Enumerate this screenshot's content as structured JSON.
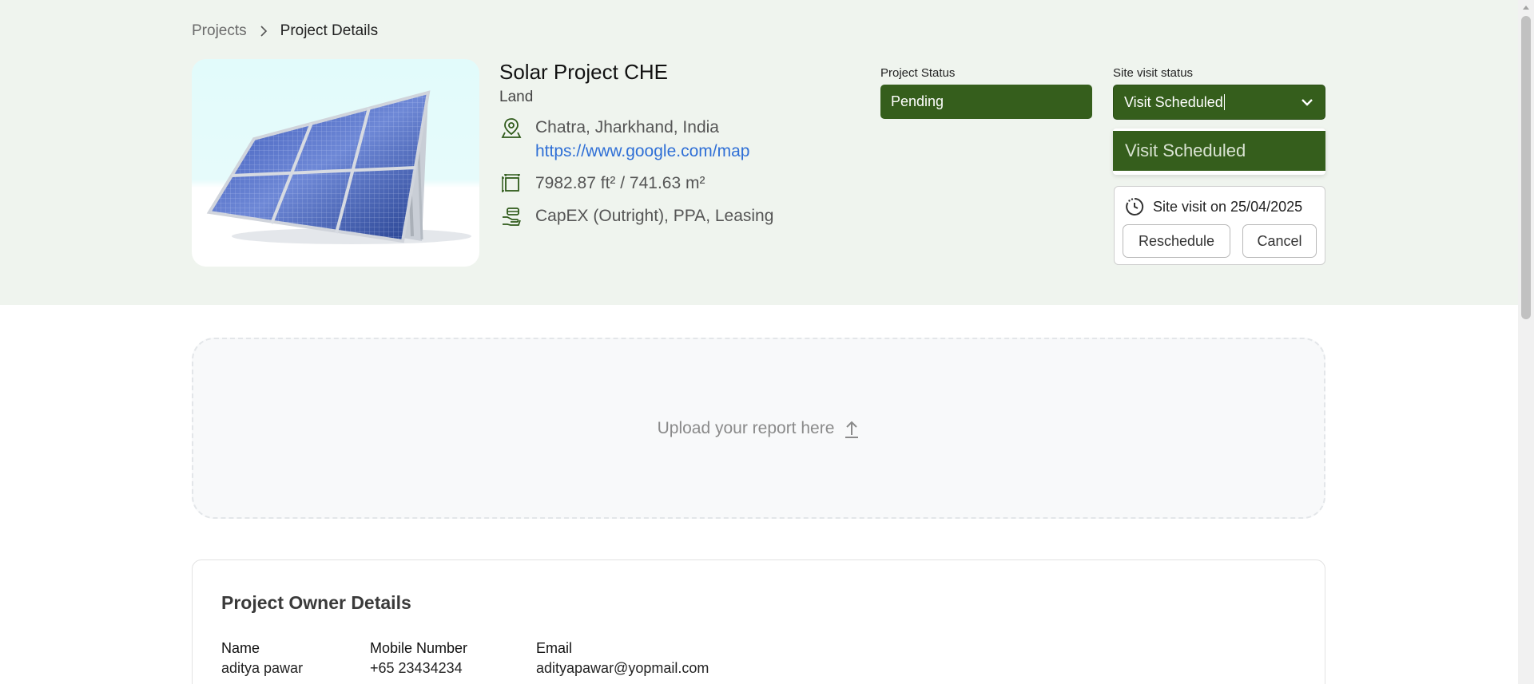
{
  "breadcrumb": {
    "parent": "Projects",
    "current": "Project Details"
  },
  "project": {
    "title": "Solar Project CHE",
    "type": "Land",
    "location": "Chatra, Jharkhand, India",
    "map_link": "https://www.google.com/map",
    "area": "7982.87 ft² / 741.63 m²",
    "financing": "CapEX (Outright), PPA, Leasing"
  },
  "project_status": {
    "label": "Project Status",
    "value": "Pending"
  },
  "site_visit": {
    "label": "Site visit status",
    "value": "Visit Scheduled",
    "options": [
      "Visit Scheduled"
    ],
    "visit_text": "Site visit on 25/04/2025",
    "reschedule_label": "Reschedule",
    "cancel_label": "Cancel"
  },
  "upload": {
    "text": "Upload your report here"
  },
  "owner": {
    "title": "Project Owner Details",
    "name_label": "Name",
    "name": "aditya pawar",
    "mobile_label": "Mobile Number",
    "mobile": "+65 23434234",
    "email_label": "Email",
    "email": "adityapawar@yopmail.com"
  },
  "colors": {
    "accent": "#355e1c",
    "hero_bg": "#eff4ee",
    "link": "#2f6fd6"
  },
  "icons": [
    "chevron-right-icon",
    "location-pin-icon",
    "area-icon",
    "finance-icon",
    "chevron-down-icon",
    "clock-icon",
    "upload-arrow-icon"
  ]
}
